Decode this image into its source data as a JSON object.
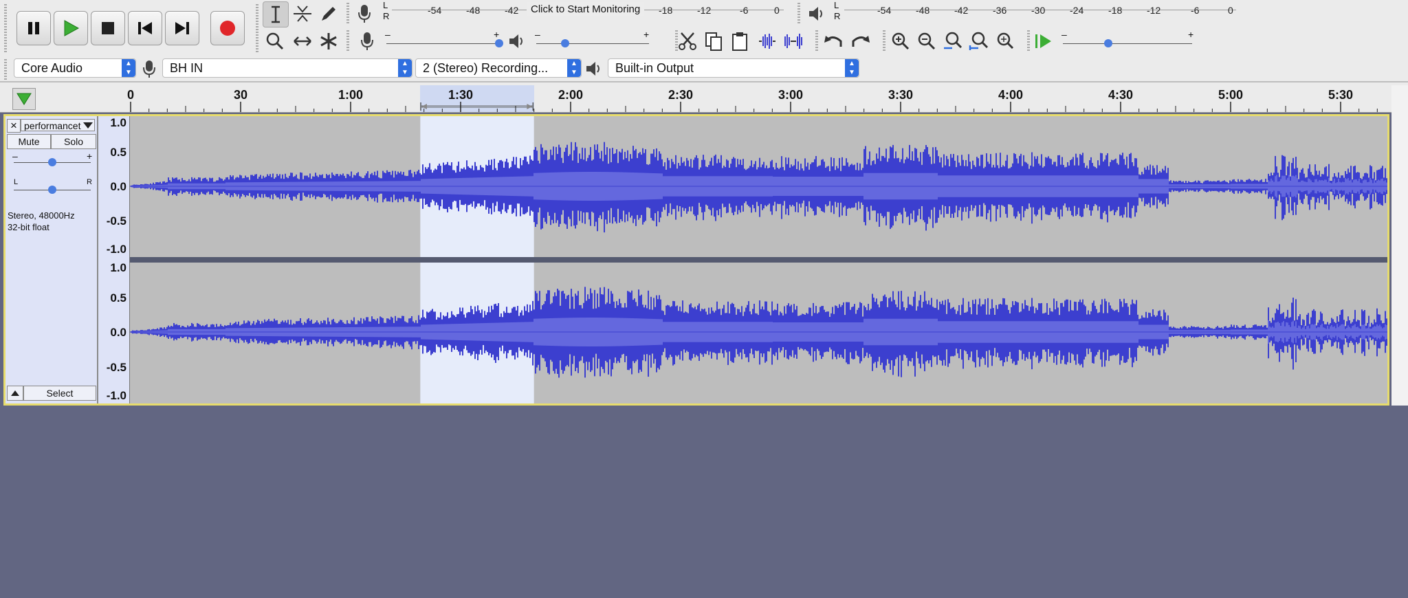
{
  "transport": {
    "pause_icon": "pause-icon",
    "play_icon": "play-icon",
    "stop_icon": "stop-icon",
    "skip_start_icon": "skip-to-start-icon",
    "skip_end_icon": "skip-to-end-icon",
    "record_icon": "record-icon",
    "record_color": "#e0262a",
    "play_color": "#3cae35"
  },
  "tools": [
    "selection-tool",
    "envelope-tool",
    "draw-tool",
    "zoom-tool",
    "time-shift-tool",
    "multi-tool"
  ],
  "recording_meter": {
    "channels": [
      "L",
      "R"
    ],
    "scale": [
      "-54",
      "-48",
      "-42",
      "-18",
      "-12",
      "-6",
      "0"
    ],
    "prompt": "Click to Start Monitoring"
  },
  "playback_meter": {
    "channels": [
      "L",
      "R"
    ],
    "scale": [
      "-54",
      "-48",
      "-42",
      "-36",
      "-30",
      "-24",
      "-18",
      "-12",
      "-6",
      "0"
    ]
  },
  "mixer": {
    "minus": "–",
    "plus": "+"
  },
  "device_toolbar": {
    "host": "Core Audio",
    "input_device": "BH IN",
    "channels": "2 (Stereo) Recording...",
    "output_device": "Built-in Output"
  },
  "timeline": {
    "labels": [
      "0",
      "30",
      "1:00",
      "1:30",
      "2:00",
      "2:30",
      "3:00",
      "3:30",
      "4:00",
      "4:30",
      "5:00",
      "5:30"
    ],
    "selection_start_s": 79,
    "selection_end_s": 110
  },
  "track": {
    "close": "×",
    "name": "performancet",
    "mute": "Mute",
    "solo": "Solo",
    "gain_minus": "–",
    "gain_plus": "+",
    "pan_left": "L",
    "pan_right": "R",
    "info_line1": "Stereo, 48000Hz",
    "info_line2": "32-bit float",
    "select": "Select",
    "scale": [
      "1.0",
      "0.5",
      "0.0",
      "-0.5",
      "-1.0"
    ],
    "wave_color": "#3c3fcf",
    "wave_rms_color": "#6468de"
  }
}
